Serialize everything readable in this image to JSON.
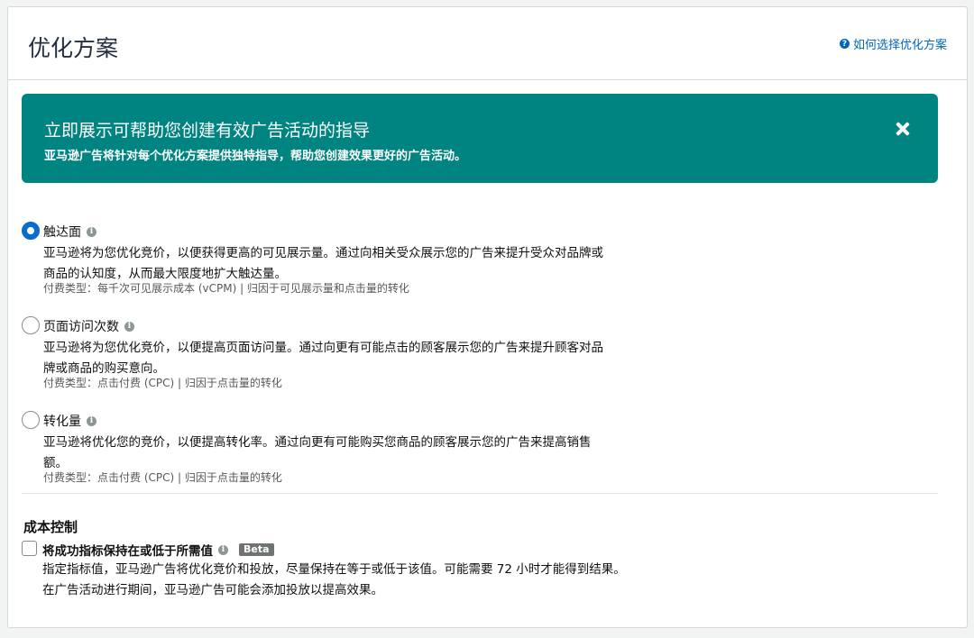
{
  "header": {
    "title": "优化方案",
    "help_link": "如何选择优化方案",
    "help_icon": "question-circle-icon"
  },
  "banner": {
    "title": "立即展示可帮助您创建有效广告活动的指导",
    "subtitle": "亚马逊广告将针对每个优化方案提供独特指导，帮助您创建效果更好的广告活动。",
    "close_icon": "close-icon",
    "color": "#008481"
  },
  "options": [
    {
      "title": "触达面",
      "selected": true,
      "desc_lines": [
        "亚马逊将为您优化竞价，以便获得更高的可见展示量。通过向相关受众展示您的广告来提升受众对品牌或",
        "商品的认知度，从而最大限度地扩大触达量。"
      ],
      "payment": "付费类型：每千次可见展示成本 (vCPM) | 归因于可见展示量和点击量的转化"
    },
    {
      "title": "页面访问次数",
      "selected": false,
      "desc_lines": [
        "亚马逊将为您优化竞价，以便提高页面访问量。通过向更有可能点击的顾客展示您的广告来提升顾客对品",
        "牌或商品的购买意向。"
      ],
      "payment": "付费类型：点击付费 (CPC) | 归因于点击量的转化"
    },
    {
      "title": "转化量",
      "selected": false,
      "desc_lines": [
        "亚马逊将优化您的竞价，以便提高转化率。通过向更有可能购买您商品的顾客展示您的广告来提高销售",
        "额。"
      ],
      "payment": "付费类型：点击付费 (CPC) | 归因于点击量的转化"
    }
  ],
  "cost_control": {
    "title": "成本控制",
    "checkbox_label": "将成功指标保持在或低于所需值",
    "checked": false,
    "badge": "Beta",
    "desc_lines": [
      "指定指标值，亚马逊广告将优化竞价和投放，尽量保持在等于或低于该值。可能需要 72 小时才能得到结果。",
      "在广告活动进行期间，亚马逊广告可能会添加投放以提高效果。"
    ]
  }
}
